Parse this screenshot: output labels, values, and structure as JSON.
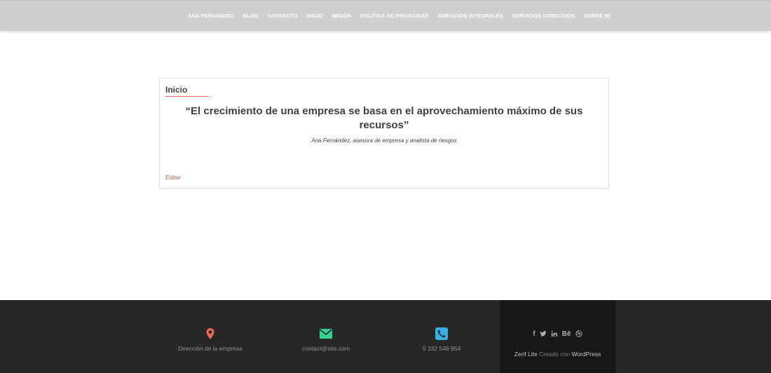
{
  "nav": {
    "items": [
      "ANA FERNÁNDEZ",
      "BLOG",
      "CONTACTO",
      "INICIO",
      "MISIÓN",
      "POLÍTICA DE PRIVACIDAD",
      "SERVICIOS INTEGRALES",
      "SERVICIOS OFRECIDOS",
      "SOBRE MÍ"
    ]
  },
  "card": {
    "title": "Inicio",
    "quote": "“El crecimiento de una empresa se basa en el aprovechamiento máximo de sus recursos”",
    "author": "Ana Fernández, asesora de empresa y analista de riesgos",
    "edit_label": "Editar"
  },
  "footer": {
    "address_label": "Dirección de la empresa",
    "email_label": "contact@site.com",
    "phone_label": "0 332 548 954",
    "social": {
      "facebook": "f",
      "behance": "Bē"
    },
    "credit": {
      "theme": "Zerif Lite",
      "made_with": "Creado con",
      "platform": "WordPress"
    },
    "colors": {
      "address_icon": "#e96656",
      "email_icon": "#34d293",
      "phone_icon": "#3ab0e2"
    }
  }
}
